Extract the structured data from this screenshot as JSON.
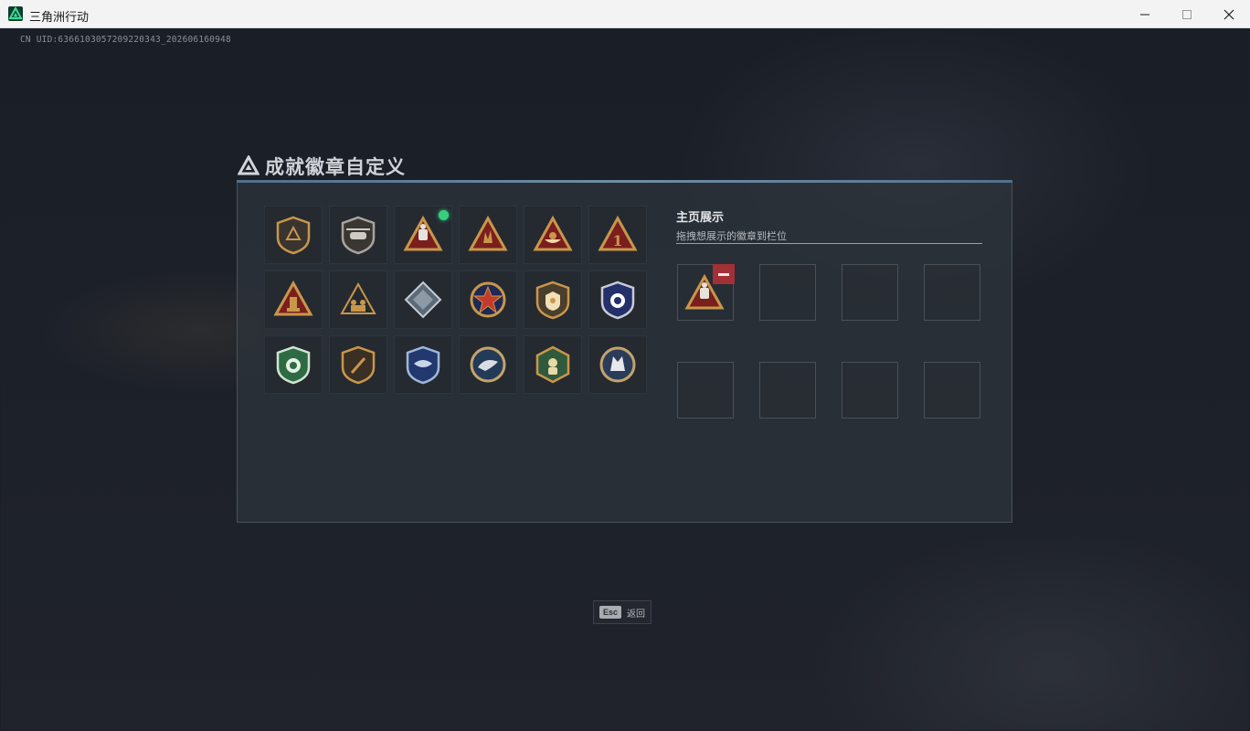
{
  "window": {
    "title": "三角洲行动",
    "icons": {
      "app": "delta-logo-icon",
      "minimize": "minimize-icon",
      "maximize": "maximize-icon",
      "close": "close-icon"
    }
  },
  "uid_text": "CN UID:6366103057209220343_202606160948",
  "dialog": {
    "title": "成就徽章自定义",
    "badges": [
      {
        "icon": "delta-shield-badge-icon",
        "selected": false
      },
      {
        "icon": "helicopter-shield-badge-icon",
        "selected": false
      },
      {
        "icon": "operator-triangle-badge-icon",
        "selected": true
      },
      {
        "icon": "hand-sign-triangle-badge-icon",
        "selected": false
      },
      {
        "icon": "boat-triangle-badge-icon",
        "selected": false
      },
      {
        "icon": "number-one-triangle-badge-icon",
        "selected": false
      },
      {
        "icon": "tower-triangle-badge-icon",
        "selected": false
      },
      {
        "icon": "squad-triangle-badge-icon",
        "selected": false
      },
      {
        "icon": "diamond-gem-badge-icon",
        "selected": false
      },
      {
        "icon": "star-emblem-badge-icon",
        "selected": false
      },
      {
        "icon": "gold-shield-badge-icon",
        "selected": false
      },
      {
        "icon": "blue-crest-badge-icon",
        "selected": false
      },
      {
        "icon": "green-lion-shield-badge-icon",
        "selected": false
      },
      {
        "icon": "knife-shield-badge-icon",
        "selected": false
      },
      {
        "icon": "blue-wings-shield-badge-icon",
        "selected": false
      },
      {
        "icon": "eagle-round-badge-icon",
        "selected": false
      },
      {
        "icon": "green-hex-badge-icon",
        "selected": false
      },
      {
        "icon": "wolf-round-badge-icon",
        "selected": false
      }
    ],
    "showcase": {
      "title": "主页展示",
      "subtitle": "拖拽想展示的徽章到栏位",
      "slots": [
        {
          "icon": "operator-triangle-badge-icon",
          "filled": true
        },
        {
          "filled": false
        },
        {
          "filled": false
        },
        {
          "filled": false
        },
        {
          "filled": false
        },
        {
          "filled": false
        },
        {
          "filled": false
        },
        {
          "filled": false
        }
      ]
    }
  },
  "esc_hint": {
    "key": "Esc",
    "label": "返回"
  },
  "colors": {
    "background": "#1b1f27",
    "selected_indicator": "#35d07f",
    "remove_button": "#a23036",
    "badge_gold": "#c9974a",
    "badge_red": "#7a1e1e"
  }
}
